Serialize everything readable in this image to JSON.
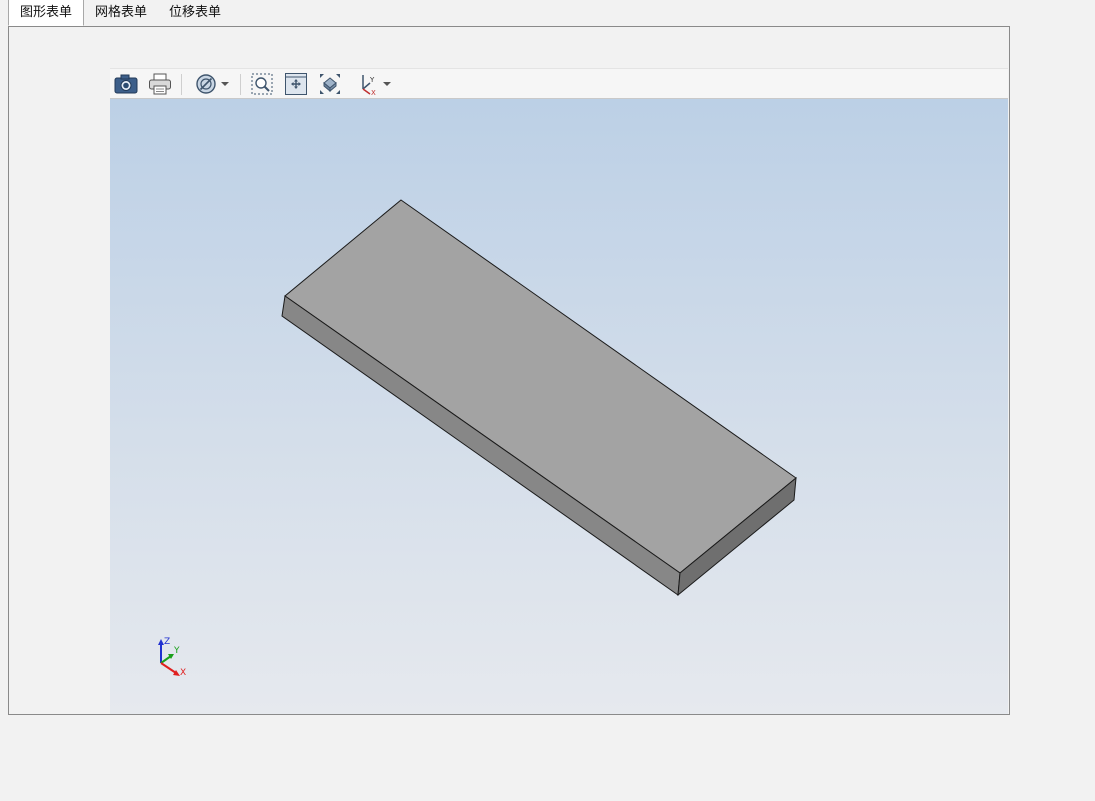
{
  "tabs": [
    {
      "label": "图形表单",
      "active": true
    },
    {
      "label": "网格表单",
      "active": false
    },
    {
      "label": "位移表单",
      "active": false
    }
  ],
  "toolbar": {
    "icons": [
      "camera-icon",
      "print-icon",
      "clip-plane-icon",
      "zoom-window-icon",
      "pan-icon",
      "fit-all-icon",
      "axis-view-icon"
    ]
  },
  "axis_triad": {
    "z": "Z",
    "y": "Y",
    "x": "X"
  },
  "colors": {
    "top_face": "#a3a3a3",
    "side_face_left": "#8a8a8a",
    "side_face_front": "#707070",
    "axis_x": "#e02020",
    "axis_y": "#1aa01a",
    "axis_z": "#2030d0"
  }
}
